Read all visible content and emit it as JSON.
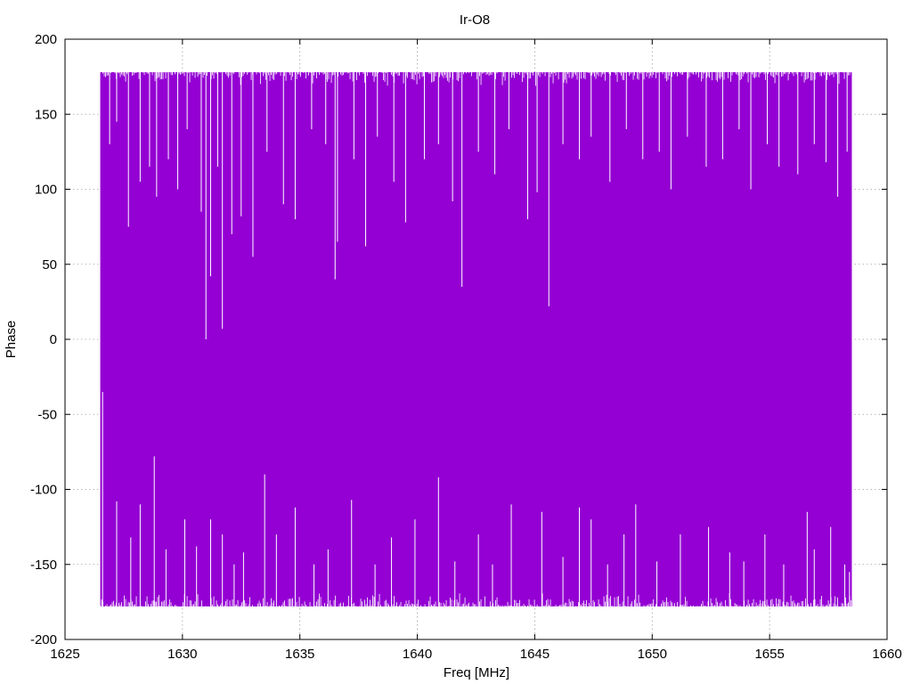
{
  "chart_data": {
    "type": "line",
    "title": "Ir-O8",
    "xlabel": "Freq [MHz]",
    "ylabel": "Phase",
    "xlim": [
      1625,
      1660
    ],
    "ylim": [
      -200,
      200
    ],
    "xticks": [
      1625,
      1630,
      1635,
      1640,
      1645,
      1650,
      1655,
      1660
    ],
    "yticks": [
      -200,
      -150,
      -100,
      -50,
      0,
      50,
      100,
      150,
      200
    ],
    "grid": true,
    "series": [
      {
        "color": "#9400d3",
        "x_start": 1626.5,
        "x_end": 1658.5,
        "band_top": 178,
        "band_bottom": -178,
        "upper_dips": [
          {
            "x": 1626.9,
            "y": 130
          },
          {
            "x": 1627.2,
            "y": 145
          },
          {
            "x": 1627.7,
            "y": 75
          },
          {
            "x": 1628.2,
            "y": 105
          },
          {
            "x": 1628.6,
            "y": 115
          },
          {
            "x": 1628.9,
            "y": 95
          },
          {
            "x": 1629.4,
            "y": 120
          },
          {
            "x": 1629.8,
            "y": 100
          },
          {
            "x": 1630.2,
            "y": 140
          },
          {
            "x": 1630.8,
            "y": 85
          },
          {
            "x": 1631.0,
            "y": 0
          },
          {
            "x": 1631.2,
            "y": 42
          },
          {
            "x": 1631.5,
            "y": 115
          },
          {
            "x": 1631.7,
            "y": 7
          },
          {
            "x": 1632.1,
            "y": 70
          },
          {
            "x": 1632.5,
            "y": 82
          },
          {
            "x": 1633.0,
            "y": 55
          },
          {
            "x": 1633.6,
            "y": 125
          },
          {
            "x": 1634.3,
            "y": 90
          },
          {
            "x": 1634.8,
            "y": 80
          },
          {
            "x": 1635.5,
            "y": 140
          },
          {
            "x": 1636.1,
            "y": 130
          },
          {
            "x": 1636.5,
            "y": 40
          },
          {
            "x": 1636.6,
            "y": 65
          },
          {
            "x": 1637.3,
            "y": 120
          },
          {
            "x": 1637.8,
            "y": 62
          },
          {
            "x": 1638.3,
            "y": 135
          },
          {
            "x": 1639.0,
            "y": 105
          },
          {
            "x": 1639.5,
            "y": 78
          },
          {
            "x": 1640.3,
            "y": 120
          },
          {
            "x": 1640.9,
            "y": 130
          },
          {
            "x": 1641.5,
            "y": 92
          },
          {
            "x": 1641.9,
            "y": 35
          },
          {
            "x": 1642.6,
            "y": 125
          },
          {
            "x": 1643.3,
            "y": 110
          },
          {
            "x": 1643.9,
            "y": 140
          },
          {
            "x": 1644.7,
            "y": 80
          },
          {
            "x": 1645.1,
            "y": 98
          },
          {
            "x": 1645.6,
            "y": 22
          },
          {
            "x": 1646.2,
            "y": 130
          },
          {
            "x": 1646.9,
            "y": 120
          },
          {
            "x": 1647.4,
            "y": 135
          },
          {
            "x": 1648.2,
            "y": 105
          },
          {
            "x": 1648.9,
            "y": 140
          },
          {
            "x": 1649.6,
            "y": 120
          },
          {
            "x": 1650.3,
            "y": 125
          },
          {
            "x": 1650.8,
            "y": 100
          },
          {
            "x": 1651.5,
            "y": 135
          },
          {
            "x": 1652.3,
            "y": 115
          },
          {
            "x": 1653.0,
            "y": 120
          },
          {
            "x": 1653.7,
            "y": 140
          },
          {
            "x": 1654.2,
            "y": 100
          },
          {
            "x": 1654.9,
            "y": 130
          },
          {
            "x": 1655.4,
            "y": 115
          },
          {
            "x": 1656.2,
            "y": 110
          },
          {
            "x": 1656.9,
            "y": 130
          },
          {
            "x": 1657.4,
            "y": 118
          },
          {
            "x": 1657.9,
            "y": 95
          },
          {
            "x": 1658.3,
            "y": 125
          }
        ],
        "lower_spikes": [
          {
            "x": 1626.6,
            "y": -35
          },
          {
            "x": 1627.2,
            "y": -108
          },
          {
            "x": 1627.8,
            "y": -132
          },
          {
            "x": 1628.2,
            "y": -110
          },
          {
            "x": 1628.8,
            "y": -78
          },
          {
            "x": 1629.3,
            "y": -140
          },
          {
            "x": 1630.1,
            "y": -120
          },
          {
            "x": 1630.6,
            "y": -138
          },
          {
            "x": 1631.2,
            "y": -120
          },
          {
            "x": 1631.7,
            "y": -130
          },
          {
            "x": 1632.2,
            "y": -150
          },
          {
            "x": 1632.6,
            "y": -142
          },
          {
            "x": 1633.5,
            "y": -90
          },
          {
            "x": 1634.0,
            "y": -130
          },
          {
            "x": 1634.8,
            "y": -112
          },
          {
            "x": 1635.6,
            "y": -150
          },
          {
            "x": 1636.2,
            "y": -140
          },
          {
            "x": 1637.2,
            "y": -107
          },
          {
            "x": 1638.2,
            "y": -150
          },
          {
            "x": 1638.9,
            "y": -132
          },
          {
            "x": 1639.9,
            "y": -120
          },
          {
            "x": 1640.9,
            "y": -92
          },
          {
            "x": 1641.6,
            "y": -148
          },
          {
            "x": 1642.6,
            "y": -130
          },
          {
            "x": 1643.2,
            "y": -150
          },
          {
            "x": 1644.0,
            "y": -110
          },
          {
            "x": 1645.3,
            "y": -115
          },
          {
            "x": 1646.2,
            "y": -145
          },
          {
            "x": 1646.9,
            "y": -112
          },
          {
            "x": 1647.4,
            "y": -120
          },
          {
            "x": 1648.1,
            "y": -150
          },
          {
            "x": 1648.8,
            "y": -130
          },
          {
            "x": 1649.3,
            "y": -110
          },
          {
            "x": 1650.2,
            "y": -148
          },
          {
            "x": 1651.2,
            "y": -130
          },
          {
            "x": 1652.4,
            "y": -125
          },
          {
            "x": 1653.3,
            "y": -142
          },
          {
            "x": 1653.9,
            "y": -148
          },
          {
            "x": 1654.8,
            "y": -130
          },
          {
            "x": 1655.6,
            "y": -150
          },
          {
            "x": 1656.6,
            "y": -115
          },
          {
            "x": 1656.9,
            "y": -140
          },
          {
            "x": 1657.6,
            "y": -125
          },
          {
            "x": 1658.2,
            "y": -150
          },
          {
            "x": 1658.4,
            "y": -155
          }
        ]
      }
    ]
  }
}
